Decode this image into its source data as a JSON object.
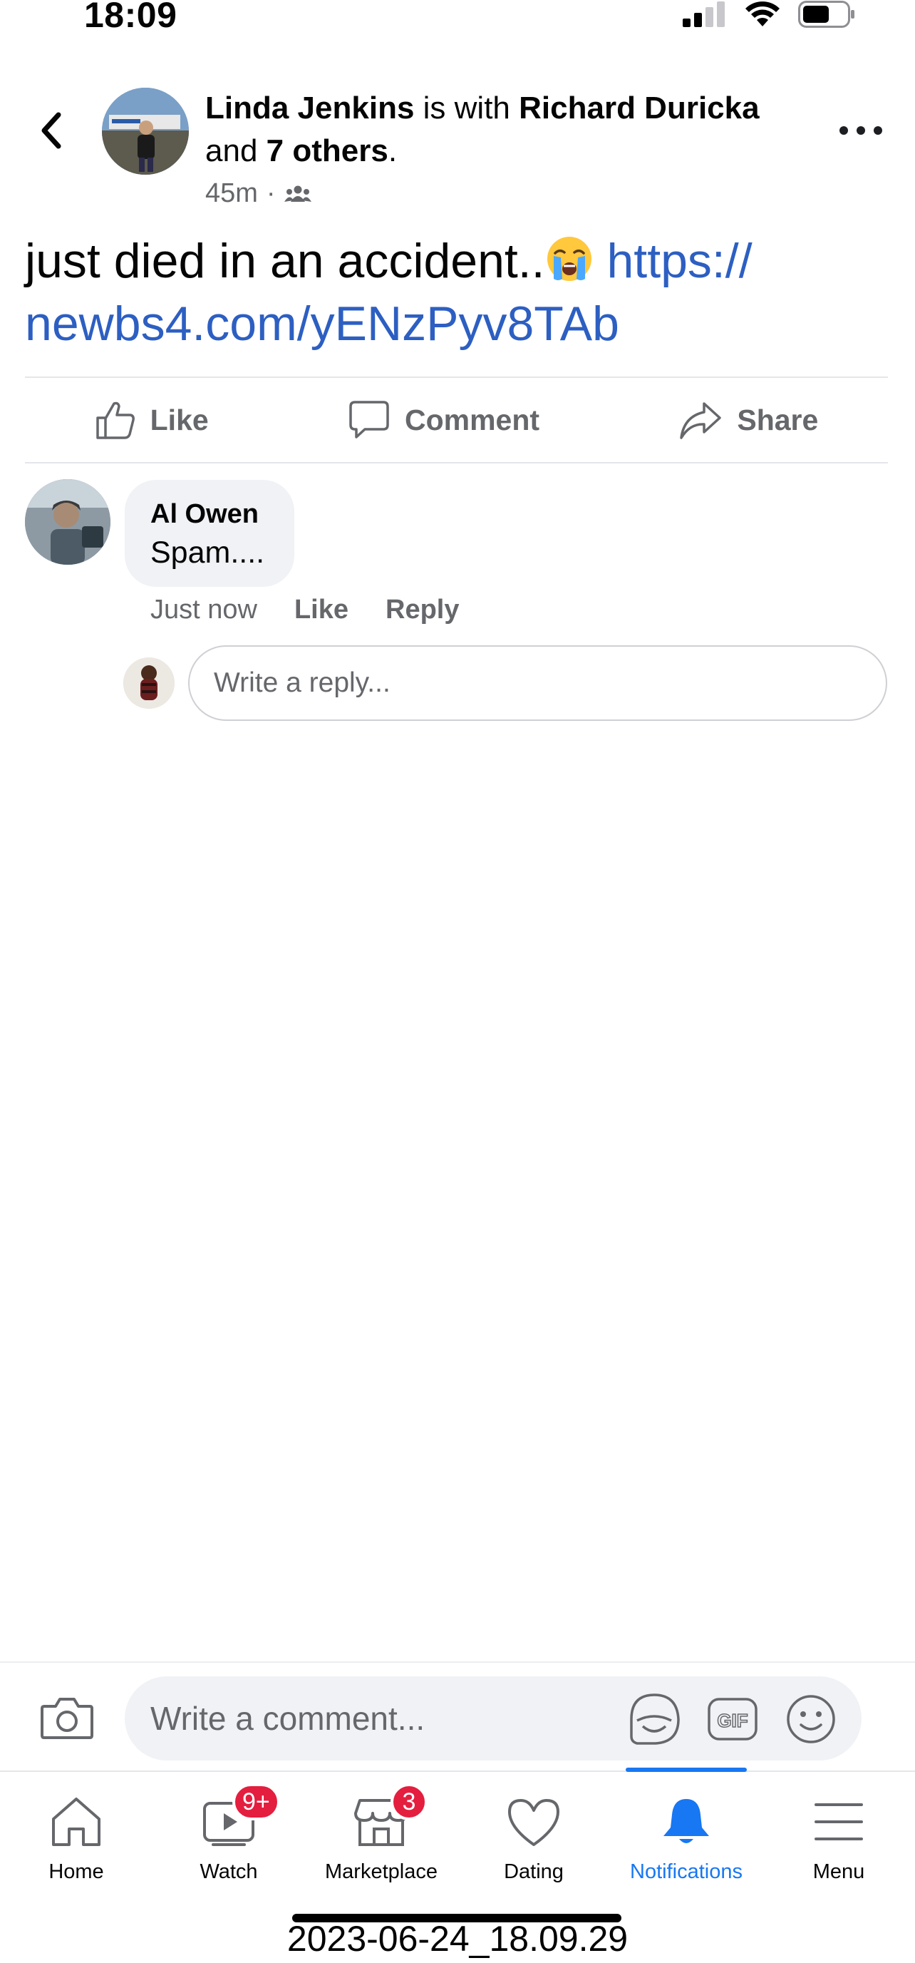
{
  "status_bar": {
    "time": "18:09"
  },
  "post": {
    "author": "Linda Jenkins",
    "with_text": "is with",
    "tagged": "Richard Duricka",
    "and_text": "and",
    "others": "7 others",
    "period": ".",
    "time_ago": "45m",
    "dot": "·",
    "audience_icon": "friends-icon",
    "body_text": "just died in an accident..",
    "emoji": "😭",
    "link_line1": "https://",
    "link_line2": "newbs4.com/yENzPyv8TAb"
  },
  "actions": {
    "like": "Like",
    "comment": "Comment",
    "share": "Share"
  },
  "comment": {
    "author": "Al Owen",
    "text": "Spam....",
    "time": "Just now",
    "like": "Like",
    "reply": "Reply"
  },
  "reply_input": {
    "placeholder": "Write a reply..."
  },
  "composer": {
    "placeholder": "Write a comment..."
  },
  "nav": {
    "home": "Home",
    "watch": "Watch",
    "watch_badge": "9+",
    "marketplace": "Marketplace",
    "marketplace_badge": "3",
    "dating": "Dating",
    "notifications": "Notifications",
    "menu": "Menu",
    "active": "notifications"
  },
  "colors": {
    "accent": "#1877f2",
    "link": "#2d5fc2",
    "badge": "#e41e3f",
    "muted": "#65676b"
  },
  "footer_timestamp": "2023-06-24_18.09.29"
}
